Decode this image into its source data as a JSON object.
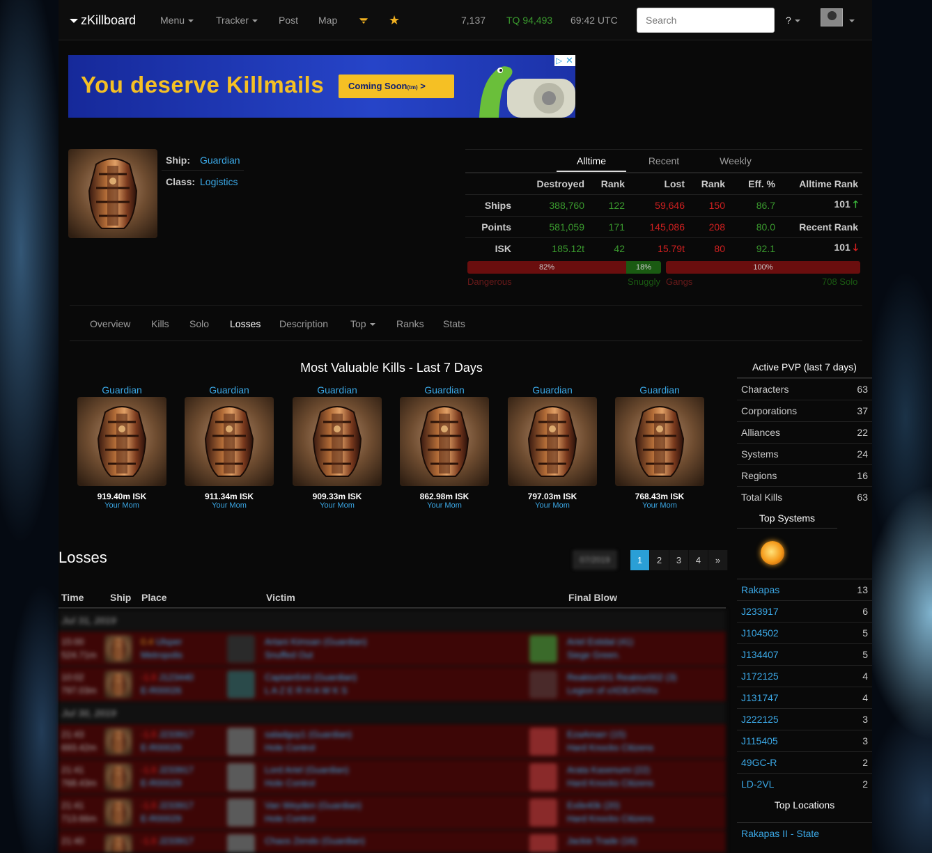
{
  "nav": {
    "brand": "zKillboard",
    "menu": "Menu",
    "tracker": "Tracker",
    "post": "Post",
    "map": "Map",
    "count": "7,137",
    "tq": "TQ 94,493",
    "time": "69:42 UTC",
    "search_placeholder": "Search",
    "help": "?"
  },
  "ad": {
    "title": "You deserve Killmails",
    "button": "Coming Soon",
    "button_suffix": "(tm)",
    "arrow": ">"
  },
  "ship": {
    "ship_label": "Ship:",
    "ship_value": "Guardian",
    "class_label": "Class:",
    "class_value": "Logistics"
  },
  "stats": {
    "tabs": [
      "Alltime",
      "Recent",
      "Weekly"
    ],
    "headers": [
      "Destroyed",
      "Rank",
      "Lost",
      "Rank",
      "Eff. %",
      "Alltime Rank"
    ],
    "rows": [
      {
        "label": "Ships",
        "destroyed": "388,760",
        "drank": "122",
        "lost": "59,646",
        "lrank": "150",
        "eff": "86.7",
        "extra": "101"
      },
      {
        "label": "Points",
        "destroyed": "581,059",
        "drank": "171",
        "lost": "145,086",
        "lrank": "208",
        "eff": "80.0",
        "extra": "Recent Rank"
      },
      {
        "label": "ISK",
        "destroyed": "185.12t",
        "drank": "42",
        "lost": "15.79t",
        "lrank": "80",
        "eff": "92.1",
        "extra": "101"
      }
    ],
    "danger_pct": "82%",
    "snuggly_pct": "18%",
    "gangs_pct": "100%",
    "danger_frac": 0.82,
    "dangerous_label": "Dangerous",
    "snuggly_label": "Snuggly",
    "gangs_label": "Gangs",
    "solo_label": "708 Solo"
  },
  "subnav": [
    "Overview",
    "Kills",
    "Solo",
    "Losses",
    "Description",
    "Top",
    "Ranks",
    "Stats"
  ],
  "most_valuable": {
    "title": "Most Valuable Kills - Last 7 Days",
    "items": [
      {
        "ship": "Guardian",
        "isk": "919.40m ISK",
        "who": "Your Mom"
      },
      {
        "ship": "Guardian",
        "isk": "911.34m ISK",
        "who": "Your Mom"
      },
      {
        "ship": "Guardian",
        "isk": "909.33m ISK",
        "who": "Your Mom"
      },
      {
        "ship": "Guardian",
        "isk": "862.98m ISK",
        "who": "Your Mom"
      },
      {
        "ship": "Guardian",
        "isk": "797.03m ISK",
        "who": "Your Mom"
      },
      {
        "ship": "Guardian",
        "isk": "768.43m ISK",
        "who": "Your Mom"
      }
    ]
  },
  "sidebar": {
    "pvp_title": "Active PVP (last 7 days)",
    "pvp": [
      {
        "label": "Characters",
        "value": "63"
      },
      {
        "label": "Corporations",
        "value": "37"
      },
      {
        "label": "Alliances",
        "value": "22"
      },
      {
        "label": "Systems",
        "value": "24"
      },
      {
        "label": "Regions",
        "value": "16"
      },
      {
        "label": "Total Kills",
        "value": "63"
      }
    ],
    "top_systems_title": "Top Systems",
    "top_systems": [
      {
        "label": "Rakapas",
        "value": "13"
      },
      {
        "label": "J233917",
        "value": "6"
      },
      {
        "label": "J104502",
        "value": "5"
      },
      {
        "label": "J134407",
        "value": "5"
      },
      {
        "label": "J172125",
        "value": "4"
      },
      {
        "label": "J131747",
        "value": "4"
      },
      {
        "label": "J222125",
        "value": "3"
      },
      {
        "label": "J115405",
        "value": "3"
      },
      {
        "label": "49GC-R",
        "value": "2"
      },
      {
        "label": "LD-2VL",
        "value": "2"
      }
    ],
    "top_locations_title": "Top Locations",
    "top_location": "Rakapas II - State"
  },
  "losses": {
    "title": "Losses",
    "month": "07/2019",
    "pages": [
      "1",
      "2",
      "3",
      "4",
      "»"
    ],
    "columns": [
      "Time",
      "Ship",
      "Place",
      "Victim",
      "Final Blow"
    ],
    "groups": [
      {
        "date": "Jul 31, 2019",
        "rows": [
          {
            "time": "15:00",
            "value": "524.71m",
            "sec": "0.4",
            "system": "Ulsper",
            "region": "Metropolis",
            "victim": "Artani Kimsan (Guardian)",
            "vcorp": "Snuffed Out",
            "fb": "Ariel Estidal (41)",
            "fbcorp": "Siege Green."
          },
          {
            "time": "10:02",
            "value": "797.03m",
            "sec": "-1.0",
            "system": "J123440",
            "region": "E-R00026",
            "victim": "Captain544 (Guardian)",
            "vcorp": "L A Z E R H A W K S",
            "fb": "Reaktor001 Reaktor002 (3)",
            "fbcorp": "Legion of xXDEATHXx"
          }
        ]
      },
      {
        "date": "Jul 30, 2019",
        "rows": [
          {
            "time": "21:43",
            "value": "693.42m",
            "sec": "-1.0",
            "system": "J233917",
            "region": "E-R00029",
            "victim": "saladguy1 (Guardian)",
            "vcorp": "Hole Control",
            "fb": "EzaAmarr (15)",
            "fbcorp": "Hard Knocks Citizens"
          },
          {
            "time": "21:41",
            "value": "768.43m",
            "sec": "-1.0",
            "system": "J233917",
            "region": "E-R00029",
            "victim": "Lord Ariel (Guardian)",
            "vcorp": "Hole Control",
            "fb": "Arata Kasenumi (22)",
            "fbcorp": "Hard Knocks Citizens"
          },
          {
            "time": "21:41",
            "value": "713.66m",
            "sec": "-1.0",
            "system": "J233917",
            "region": "E-R00029",
            "victim": "Van Weyden (Guardian)",
            "vcorp": "Hole Control",
            "fb": "Exile40k (20)",
            "fbcorp": "Hard Knocks Citizens"
          },
          {
            "time": "21:40",
            "value": "",
            "sec": "-1.0",
            "system": "J233917",
            "region": "",
            "victim": "Chaos Zendo (Guardian)",
            "vcorp": "",
            "fb": "Jackie Trade (16)",
            "fbcorp": ""
          }
        ]
      }
    ]
  }
}
